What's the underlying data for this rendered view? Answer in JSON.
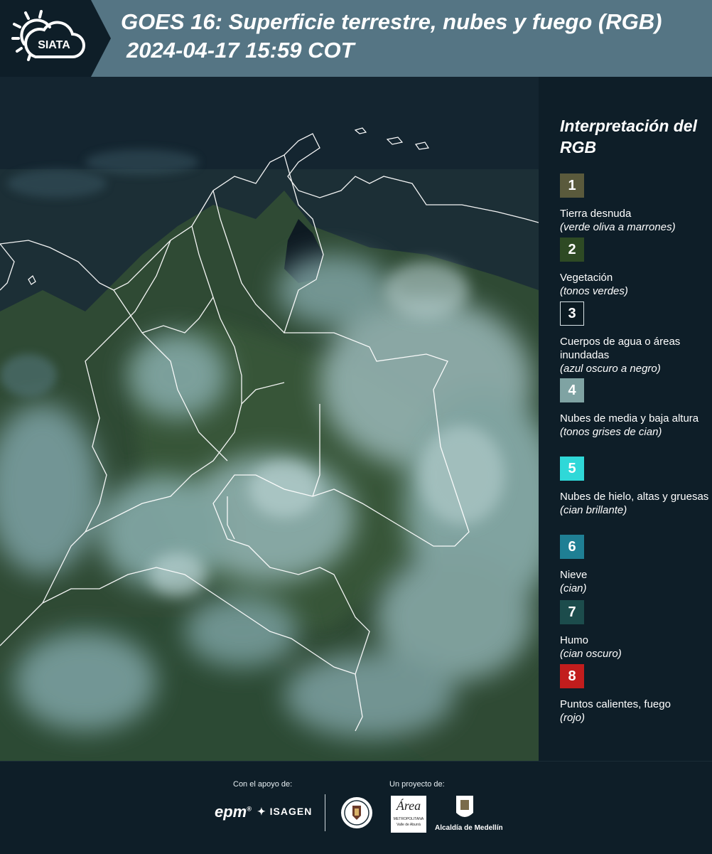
{
  "header": {
    "logo_text": "SIATA",
    "title": "GOES 16: Superficie terrestre, nubes y fuego (RGB)",
    "subtitle": "2024-04-17 15:59 COT"
  },
  "legend": {
    "title": "Interpretación del RGB",
    "items": [
      {
        "num": "1",
        "label": "Tierra desnuda",
        "desc": "(verde oliva a marrones)",
        "color": "#5a5a3c"
      },
      {
        "num": "2",
        "label": "Vegetación",
        "desc": "(tonos verdes)",
        "color": "#2e4a24"
      },
      {
        "num": "3",
        "label": "Cuerpos de agua o áreas inundadas",
        "desc": "(azul oscuro a negro)",
        "color": "#0b1a22"
      },
      {
        "num": "4",
        "label": "Nubes de media y baja altura",
        "desc": "(tonos grises de cian)",
        "color": "#7fa3a3"
      },
      {
        "num": "5",
        "label": "Nubes de hielo, altas y gruesas",
        "desc": "(cian brillante)",
        "color": "#2fd8d8"
      },
      {
        "num": "6",
        "label": "Nieve",
        "desc": "(cian)",
        "color": "#1f7f94"
      },
      {
        "num": "7",
        "label": "Humo",
        "desc": "(cian oscuro)",
        "color": "#1c4c4c"
      },
      {
        "num": "8",
        "label": "Puntos calientes, fuego",
        "desc": "(rojo)",
        "color": "#c21d1d"
      }
    ]
  },
  "footer": {
    "support_label": "Con el apoyo de:",
    "project_label": "Un proyecto de:",
    "brand_epm": "epm",
    "brand_isagen": "ISAGEN",
    "brand_area_main": "Área",
    "brand_area_sub": "METROPOLITANA",
    "brand_area_sub2": "Valle de Aburrá",
    "brand_alcaldia": "Alcaldía de Medellín"
  }
}
